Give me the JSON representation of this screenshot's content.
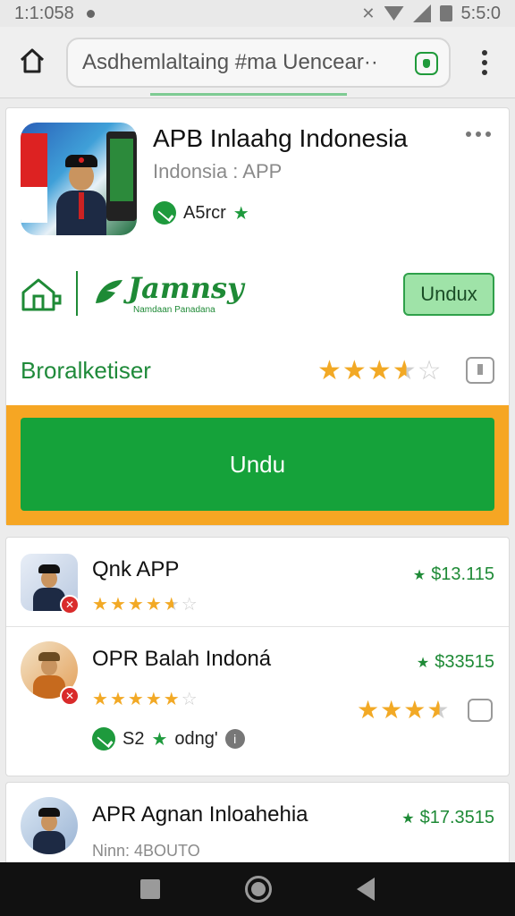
{
  "status_bar": {
    "time": "1:1:058",
    "right_time": "5:5:0"
  },
  "browser": {
    "url_text": "Asdhemlaltaing #ma Uencear··"
  },
  "hero": {
    "title": "APB Inlaahg Indonesia",
    "subtitle": "Indonsia : APP",
    "badge_text": "A5rcr",
    "brand_name": "Jamnsy",
    "brand_tagline": "Namdaan Panadana",
    "small_button_label": "Undux",
    "rating_label": "Broralketiser",
    "rating": 3.5,
    "cta_label": "Undu"
  },
  "list": [
    {
      "title": "Qnk APP",
      "price": "$13.115",
      "rating": 4.5
    },
    {
      "title": "OPR Balah Indoná",
      "price": "$33515",
      "rating": 4,
      "side_rating": 3.5,
      "meta": "S2",
      "meta_text": "odng'"
    },
    {
      "title": "APR Agnan Inloahehia",
      "price": "$17.3515",
      "subtitle": "Ninn: 4BOUTO"
    }
  ],
  "colors": {
    "accent_green": "#15a23a",
    "cta_frame": "#f6a623",
    "star": "#f2a925",
    "badge_red": "#d92b2b"
  },
  "icons": {
    "nav": [
      "home-icon",
      "menu-icon",
      "shield-icon"
    ],
    "system_nav": [
      "square-icon",
      "circle-icon",
      "back-icon"
    ]
  }
}
